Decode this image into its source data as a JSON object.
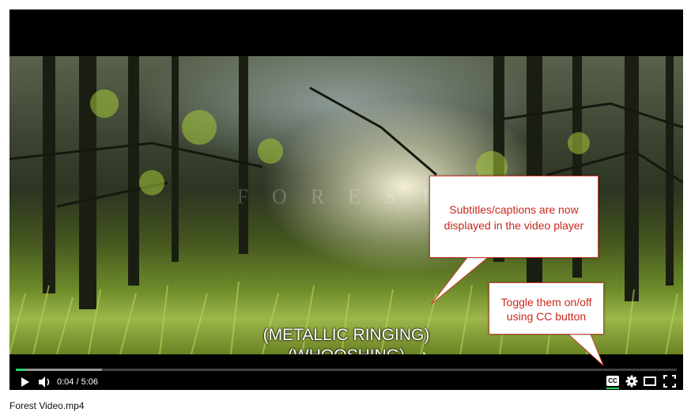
{
  "player": {
    "watermark": "FOREST",
    "captions": [
      "(METALLIC RINGING)",
      "(WHOOSHING)"
    ],
    "controls": {
      "time_display": "0:04 / 5:06",
      "progress": {
        "played_fraction": 0.014,
        "buffered_fraction": 0.13
      },
      "cc_label": "CC",
      "icons": [
        "play-icon",
        "volume-icon",
        "settings-icon",
        "theater-mode-icon",
        "fullscreen-icon"
      ]
    }
  },
  "callouts": {
    "subtitles": "Subtitles/captions are now displayed in the video player",
    "toggle": "Toggle them on/off using CC button"
  },
  "file": {
    "name": "Forest Video.mp4"
  },
  "colors": {
    "progress_played": "#2ad463",
    "callout_border": "#d04030",
    "callout_text": "#c8281c"
  }
}
